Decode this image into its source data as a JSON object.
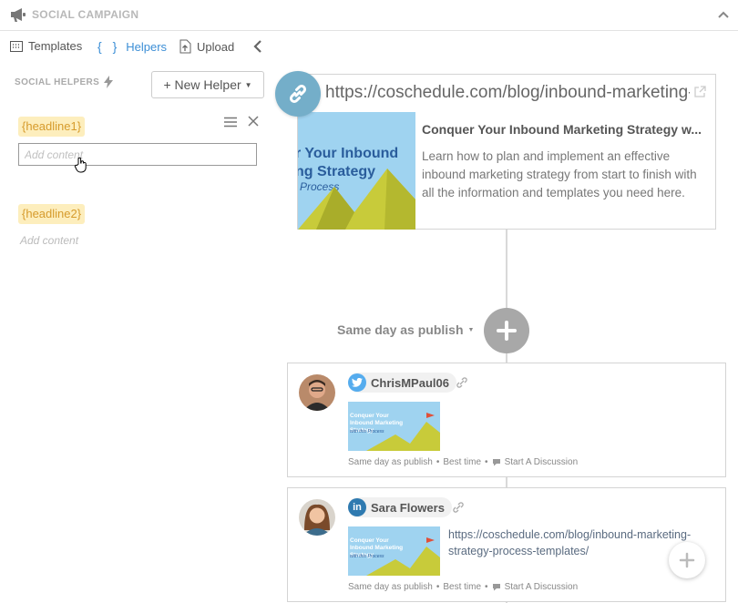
{
  "header": {
    "title": "SOCIAL CAMPAIGN"
  },
  "toolbar": {
    "templates_label": "Templates",
    "helpers_label": "Helpers",
    "upload_label": "Upload"
  },
  "sidebar": {
    "section_label": "SOCIAL HELPERS",
    "new_helper_label": "+ New Helper",
    "helpers": [
      {
        "tag": "{headline1}",
        "placeholder": "Add content"
      },
      {
        "tag": "{headline2}",
        "placeholder": "Add content"
      }
    ]
  },
  "link_preview": {
    "url": "https://coschedule.com/blog/inbound-marketing-strategy-process-templates/",
    "thumb_line1": "r Your Inbound",
    "thumb_line2": "ng Strategy",
    "thumb_line3": "Process",
    "title": "Conquer Your Inbound Marketing Strategy w...",
    "description": "Learn how to plan and implement an effective inbound marketing strategy from start to finish with all the information and templates you need here."
  },
  "schedule": {
    "label": "Same day as publish"
  },
  "messages": [
    {
      "network": "twitter",
      "account": "ChrisMPaul06",
      "thumb_line1": "Conquer Your Inbound Marketing Strategy",
      "thumb_line2": "with this Process",
      "text": "",
      "meta_when": "Same day as publish",
      "meta_time": "Best time",
      "meta_discussion": "Start A Discussion"
    },
    {
      "network": "linkedin",
      "account": "Sara Flowers",
      "thumb_line1": "Conquer Your Inbound Marketing Strategy",
      "thumb_line2": "with this Process",
      "text": "https://coschedule.com/blog/inbound-marketing-strategy-process-templates/",
      "meta_when": "Same day as publish",
      "meta_time": "Best time",
      "meta_discussion": "Start A Discussion"
    }
  ],
  "colors": {
    "accent": "#3d8fd6",
    "helper_tag_bg": "#fdeebd",
    "helper_tag_text": "#d69b2c",
    "link_circle": "#74aec9",
    "twitter": "#55acee",
    "linkedin": "#2f7ab0"
  },
  "icons": [
    "megaphone-icon",
    "chevron-up-icon",
    "templates-icon",
    "braces-icon",
    "upload-icon",
    "chevron-left-icon",
    "lightning-icon",
    "menu-icon",
    "close-icon",
    "hand-cursor-icon",
    "link-icon",
    "external-link-icon",
    "plus-icon",
    "twitter-icon",
    "linkedin-icon",
    "chat-icon"
  ]
}
